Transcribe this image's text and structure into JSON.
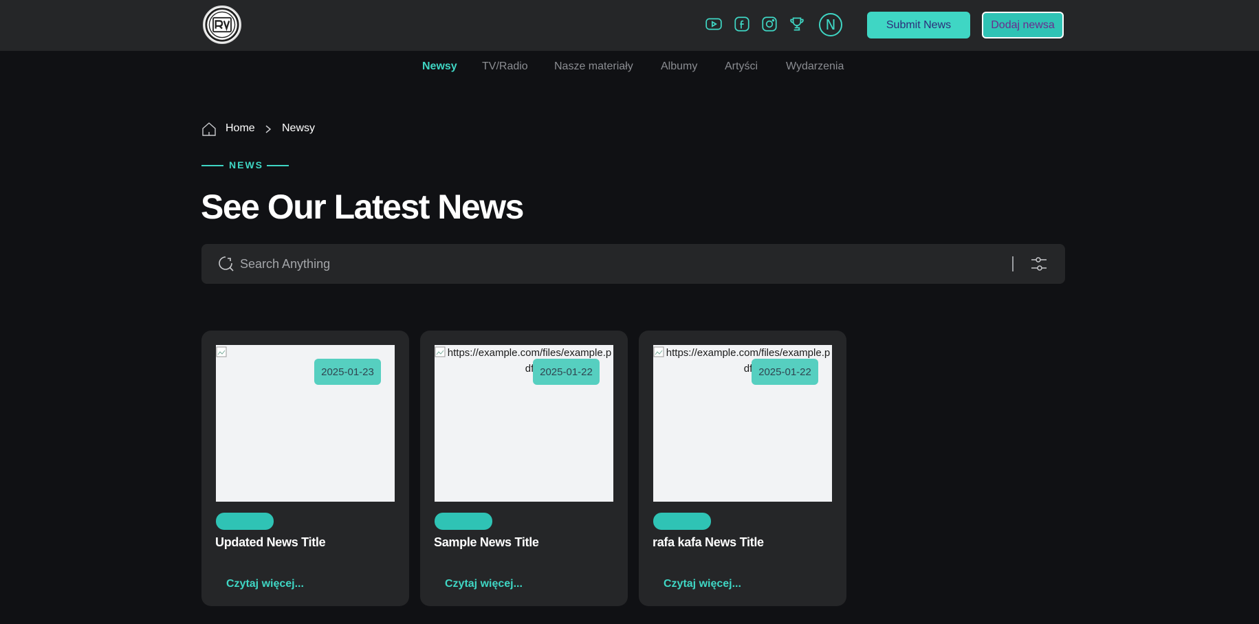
{
  "header": {
    "submit_label": "Submit News",
    "dodaj_label": "Dodaj newsa",
    "profile_initial": "N",
    "colors": {
      "accent": "#3fd6c4",
      "header_bg": "#252628",
      "page_bg": "#101114"
    },
    "social_icons": [
      "youtube-icon",
      "facebook-icon",
      "instagram-icon",
      "trophy-icon"
    ]
  },
  "nav": {
    "items": [
      {
        "label": "Newsy",
        "active": true
      },
      {
        "label": "TV/Radio"
      },
      {
        "label": "Nasze materiały"
      },
      {
        "label": "Albumy"
      },
      {
        "label": "Artyści"
      },
      {
        "label": "Wydarzenia"
      }
    ]
  },
  "breadcrumb": {
    "home": "Home",
    "current": "Newsy"
  },
  "section": {
    "label": "NEWS",
    "title": "See Our Latest News"
  },
  "search": {
    "placeholder": "Search Anything"
  },
  "cards": [
    {
      "date": "2025-01-23",
      "title": "Updated News Title",
      "image_alt": "",
      "read_more": "Czytaj więcej..."
    },
    {
      "date": "2025-01-22",
      "title": "Sample News Title",
      "image_alt": "https://example.com/files/example.pdf",
      "read_more": "Czytaj więcej..."
    },
    {
      "date": "2025-01-22",
      "title": "rafa kafa News Title",
      "image_alt": "https://example.com/files/example.pdf",
      "read_more": "Czytaj więcej..."
    }
  ]
}
